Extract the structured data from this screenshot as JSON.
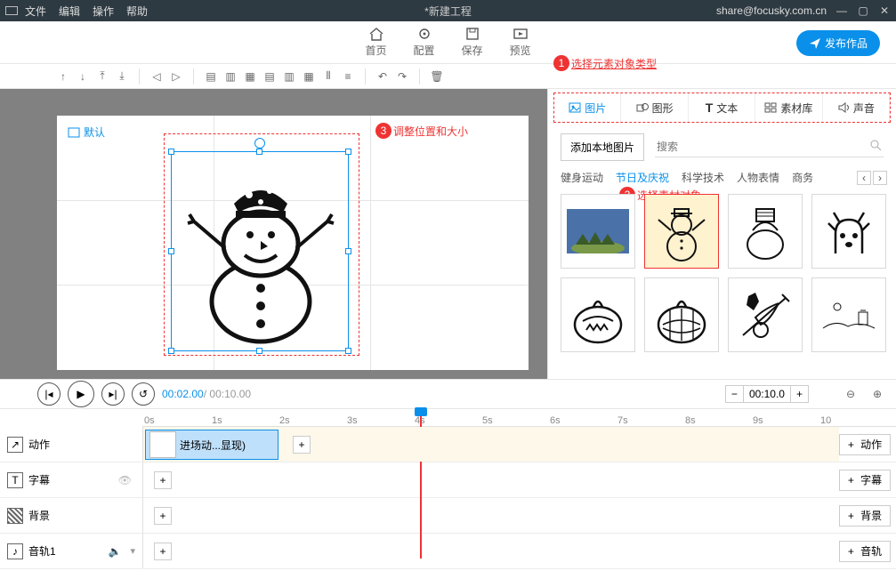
{
  "menubar": {
    "items": [
      "文件",
      "编辑",
      "操作",
      "帮助"
    ],
    "title": "*新建工程",
    "account": "share@focusky.com.cn"
  },
  "topnav": {
    "items": [
      "首页",
      "配置",
      "保存",
      "预览"
    ],
    "publish": "发布作品"
  },
  "annotations": {
    "a1": "选择元素对象类型",
    "a2": "选择素材对象",
    "a3": "调整位置和大小"
  },
  "canvas": {
    "frame_label": "默认"
  },
  "panel": {
    "tabs": [
      "图片",
      "图形",
      "文本",
      "素材库",
      "声音"
    ],
    "add_local": "添加本地图片",
    "search_ph": "搜索",
    "categories": [
      "健身运动",
      "节日及庆祝",
      "科学技术",
      "人物表情",
      "商务"
    ]
  },
  "playback": {
    "current": "00:02.00",
    "total": "00:10.00",
    "zoom_val": "00:10.0"
  },
  "ruler": [
    "0s",
    "1s",
    "2s",
    "3s",
    "4s",
    "5s",
    "6s",
    "7s",
    "8s",
    "9s",
    "10"
  ],
  "tracks": {
    "action": {
      "label": "动作",
      "clip": "进场动...显现)",
      "rbtn": "动作"
    },
    "subtitle": {
      "label": "字幕",
      "rbtn": "字幕"
    },
    "bg": {
      "label": "背景",
      "rbtn": "背景"
    },
    "audio": {
      "label": "音轨1",
      "rbtn": "音轨"
    }
  },
  "plus": "+"
}
